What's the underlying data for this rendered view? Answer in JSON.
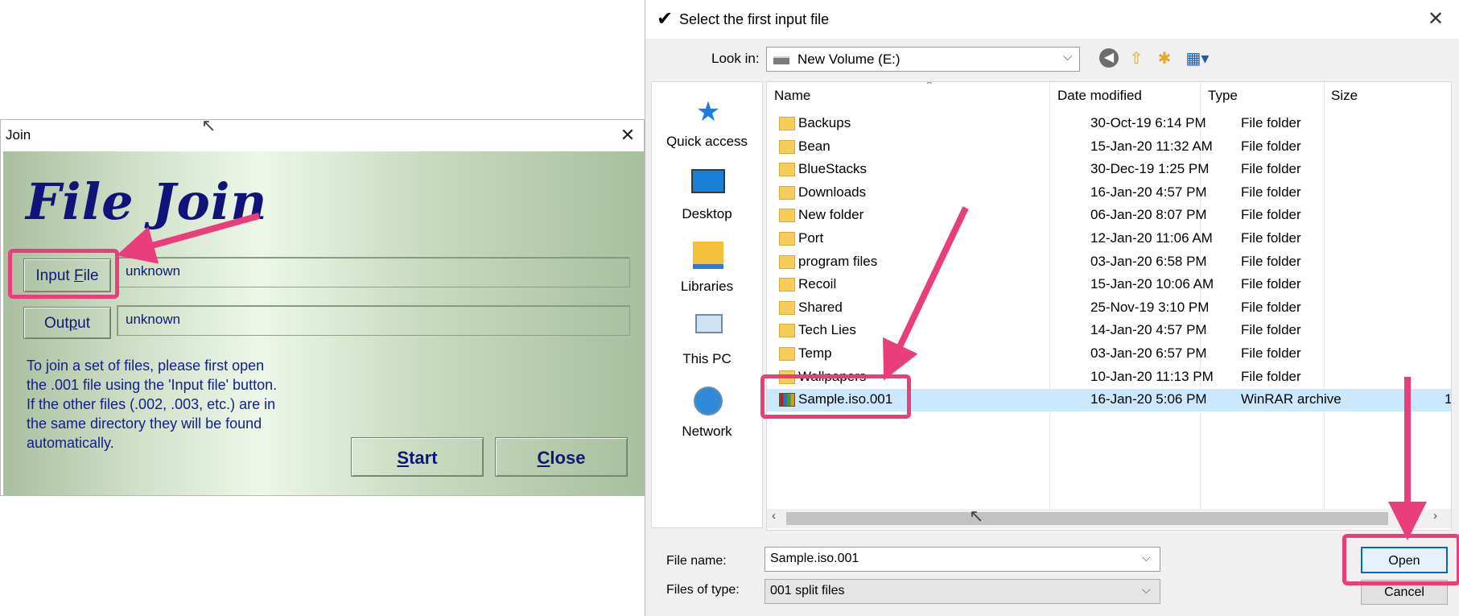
{
  "join_window": {
    "title": "Join",
    "heading": "File Join",
    "input_label_pre": "Input ",
    "input_label_ul": "F",
    "input_label_post": "ile",
    "input_value": "unknown",
    "output_label_pre": "Out",
    "output_label_ul": "p",
    "output_label_post": "ut",
    "output_value": "unknown",
    "instructions": "To join a set of files, please first open\nthe .001 file using the 'Input file' button.\nIf the other files (.002, .003, etc.) are in\nthe same directory they will be found\nautomatically.",
    "start_ul": "S",
    "start_rest": "tart",
    "close_ul": "C",
    "close_rest": "lose",
    "close_icon": "✕"
  },
  "dialog": {
    "title": "Select the first input file",
    "check_icon": "✔",
    "close_icon": "✕",
    "look_in_label": "Look in:",
    "look_in_value": "New Volume (E:)",
    "toolbar_icons": [
      "back-icon",
      "up-folder-icon",
      "new-folder-icon",
      "view-menu-icon"
    ],
    "places": [
      {
        "label": "Quick access"
      },
      {
        "label": "Desktop"
      },
      {
        "label": "Libraries"
      },
      {
        "label": "This PC"
      },
      {
        "label": "Network"
      }
    ],
    "columns": {
      "name": "Name",
      "date": "Date modified",
      "type": "Type",
      "size": "Size"
    },
    "files": [
      {
        "name": "Backups",
        "date": "30-Oct-19 6:14 PM",
        "type": "File folder",
        "size": ""
      },
      {
        "name": "Bean",
        "date": "15-Jan-20 11:32 AM",
        "type": "File folder",
        "size": ""
      },
      {
        "name": "BlueStacks",
        "date": "30-Dec-19 1:25 PM",
        "type": "File folder",
        "size": ""
      },
      {
        "name": "Downloads",
        "date": "16-Jan-20 4:57 PM",
        "type": "File folder",
        "size": ""
      },
      {
        "name": "New folder",
        "date": "06-Jan-20 8:07 PM",
        "type": "File folder",
        "size": ""
      },
      {
        "name": "Port",
        "date": "12-Jan-20 11:06 AM",
        "type": "File folder",
        "size": ""
      },
      {
        "name": "program files",
        "date": "03-Jan-20 6:58 PM",
        "type": "File folder",
        "size": ""
      },
      {
        "name": "Recoil",
        "date": "15-Jan-20 10:06 AM",
        "type": "File folder",
        "size": ""
      },
      {
        "name": "Shared",
        "date": "25-Nov-19 3:10 PM",
        "type": "File folder",
        "size": ""
      },
      {
        "name": "Tech Lies",
        "date": "14-Jan-20 4:57 PM",
        "type": "File folder",
        "size": ""
      },
      {
        "name": "Temp",
        "date": "03-Jan-20 6:57 PM",
        "type": "File folder",
        "size": ""
      },
      {
        "name": "Wallpapers",
        "date": "10-Jan-20 11:13 PM",
        "type": "File folder",
        "size": ""
      },
      {
        "name": "Sample.iso.001",
        "date": "16-Jan-20 5:06 PM",
        "type": "WinRAR archive",
        "size": "1",
        "selected": true
      }
    ],
    "file_name_label": "File name:",
    "file_name_value": "Sample.iso.001",
    "file_type_label": "Files of type:",
    "file_type_value": "001 split files",
    "open_label": "Open",
    "cancel_label": "Cancel"
  },
  "colors": {
    "highlight": "#e83e7b",
    "join_heading": "#101478",
    "selected_row": "#cce8ff"
  }
}
